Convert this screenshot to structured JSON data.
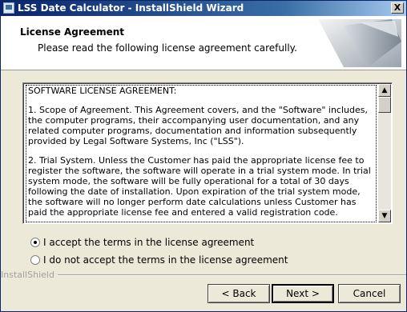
{
  "window": {
    "title": "LSS Date Calculator - InstallShield Wizard",
    "close_glyph": "X"
  },
  "header": {
    "title": "License Agreement",
    "subtitle": "Please read the following license agreement carefully."
  },
  "license": {
    "paragraphs": [
      "SOFTWARE LICENSE AGREEMENT:",
      "1.  Scope of Agreement.  This Agreement covers, and the \"Software\" includes, the computer programs, their accompanying user documentation, and any related computer programs, documentation and information subsequently provided by Legal Software Systems, Inc (\"LSS\").",
      "2.  Trial System.  Unless the Customer has paid the appropriate license fee to register the software, the software will operate in a trial system mode.  In trial system mode, the software will be fully operational for a total of 30 days following the date of installation. Upon expiration of the trial system mode, the software will no longer perform date calculations unless Customer has paid the appropriate license fee and entered a valid registration code."
    ]
  },
  "options": {
    "accept_label": "I accept the terms in the license agreement",
    "decline_label": "I do not accept the terms in the license agreement",
    "selected": "accept"
  },
  "footer": {
    "brand": "InstallShield",
    "back_label": "< Back",
    "next_label": "Next >",
    "cancel_label": "Cancel"
  },
  "icons": [
    "setup-app-icon",
    "close-icon",
    "scroll-up-arrow-icon",
    "scroll-down-arrow-icon",
    "header-banner-graphic"
  ]
}
